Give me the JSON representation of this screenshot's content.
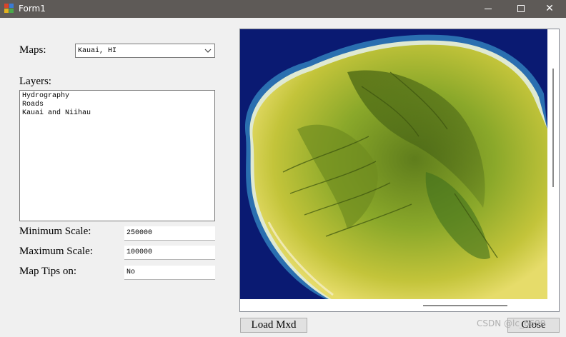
{
  "window": {
    "title": "Form1",
    "icon": "form-app-icon",
    "controls": {
      "minimize": "minimize-icon",
      "maximize": "maximize-icon",
      "close": "close-icon",
      "close_glyph": "✕"
    }
  },
  "maps": {
    "label": "Maps:",
    "selected": "Kauai, HI"
  },
  "layers": {
    "label": "Layers:",
    "items": [
      "Hydrography",
      "Roads",
      "Kauai and Niihau"
    ]
  },
  "scale": {
    "min_label": "Minimum Scale:",
    "min_value": "250000",
    "max_label": "Maximum Scale:",
    "max_value": "100000"
  },
  "map_tips": {
    "label": "Map Tips on:",
    "value": "No"
  },
  "map_view": {
    "content": "satellite-image-kauai"
  },
  "buttons": {
    "load_mxd": "Load Mxd",
    "close": "Close"
  },
  "watermark": "CSDN @lc_6699",
  "colors": {
    "titlebar": "#5e5a57",
    "ocean": "#0a1a72",
    "vegetation": "#8aa82a"
  }
}
